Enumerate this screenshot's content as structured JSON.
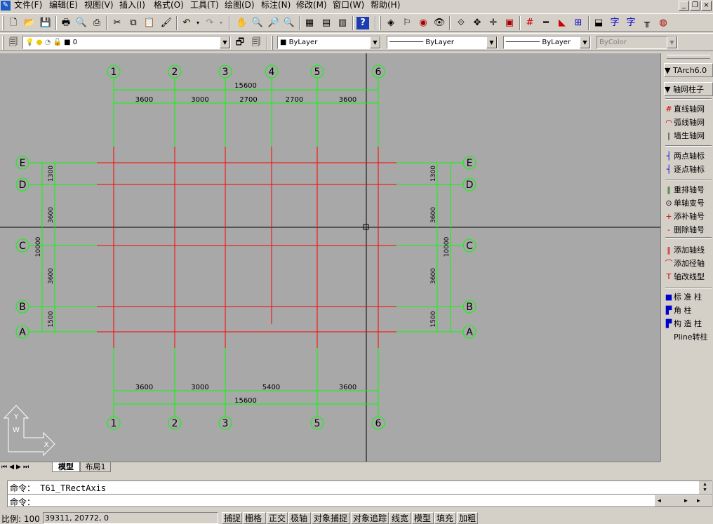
{
  "menu": {
    "items": [
      "文件(F)",
      "编辑(E)",
      "视图(V)",
      "插入(I)",
      "格式(O)",
      "工具(T)",
      "绘图(D)",
      "标注(N)",
      "修改(M)",
      "窗口(W)",
      "帮助(H)"
    ]
  },
  "window": {
    "min": "_",
    "restore": "❐",
    "close": "×"
  },
  "layer": {
    "name": "0"
  },
  "props": {
    "color": "ByLayer",
    "linetype": "ByLayer",
    "lineweight": "ByLayer",
    "plotstyle": "ByColor"
  },
  "drawing": {
    "top_axes": [
      "1",
      "2",
      "3",
      "4",
      "5",
      "6"
    ],
    "bottom_axes": [
      "1",
      "2",
      "3",
      "5",
      "6"
    ],
    "left_axes": [
      "E",
      "D",
      "C",
      "B",
      "A"
    ],
    "right_axes": [
      "E",
      "D",
      "C",
      "B",
      "A"
    ],
    "top_total": "15600",
    "top_dims": [
      "3600",
      "3000",
      "2700",
      "2700",
      "3600"
    ],
    "bottom_dims": [
      "3600",
      "3000",
      "5400",
      "3600"
    ],
    "bottom_total": "15600",
    "left_dims": [
      "1300",
      "3600",
      "3600",
      "1500"
    ],
    "left_total": "10000",
    "right_dims": [
      "1300",
      "3600",
      "3600",
      "1500"
    ],
    "right_total": "10000",
    "ucs_y": "Y",
    "ucs_w": "W",
    "ucs_x": "X"
  },
  "panel": {
    "title": "TArch6.0",
    "section": "轴网柱子",
    "items": [
      {
        "icon": "#",
        "label": "直线轴网",
        "color": "#cc0000"
      },
      {
        "icon": "◠",
        "label": "弧线轴网",
        "color": "#cc0000"
      },
      {
        "icon": "|",
        "label": "墙生轴网",
        "color": "#000000"
      },
      {
        "icon": "┤",
        "label": "两点轴标",
        "color": "#0000cc"
      },
      {
        "icon": "┤",
        "label": "逐点轴标",
        "color": "#0000cc"
      },
      {
        "icon": "‖",
        "label": "重排轴号",
        "color": "#006600"
      },
      {
        "icon": "⊙",
        "label": "单轴变号",
        "color": "#000000"
      },
      {
        "icon": "+",
        "label": "添补轴号",
        "color": "#cc0000"
      },
      {
        "icon": "-",
        "label": "删除轴号",
        "color": "#cc0000"
      },
      {
        "icon": "‖",
        "label": "添加轴线",
        "color": "#cc0000"
      },
      {
        "icon": "⌒",
        "label": "添加径轴",
        "color": "#cc0000"
      },
      {
        "icon": "T",
        "label": "轴改线型",
        "color": "#cc0000"
      },
      {
        "icon": "■",
        "label": "标 准 柱",
        "color": "#0000cc"
      },
      {
        "icon": "▛",
        "label": "角     柱",
        "color": "#0000cc"
      },
      {
        "icon": "▛",
        "label": "构 造 柱",
        "color": "#0000cc"
      },
      {
        "icon": "",
        "label": "Pline转柱",
        "color": "#000000"
      }
    ]
  },
  "tabs": {
    "items": [
      "模型",
      "布局1"
    ]
  },
  "command": {
    "line1": "命令： T61_TRectAxis",
    "line2": "命令："
  },
  "status": {
    "scale": "比例: 100",
    "coords": "39311, 20772, 0",
    "buttons": [
      "捕捉",
      "栅格",
      "正交",
      "极轴",
      "对象捕捉",
      "对象追踪",
      "线宽",
      "模型",
      "填充",
      "加粗"
    ]
  },
  "colors": {
    "canvas": "#a8a8a8",
    "axis_red": "#ff0000",
    "dim_green": "#00ff00",
    "ui": "#d4d0c8"
  }
}
